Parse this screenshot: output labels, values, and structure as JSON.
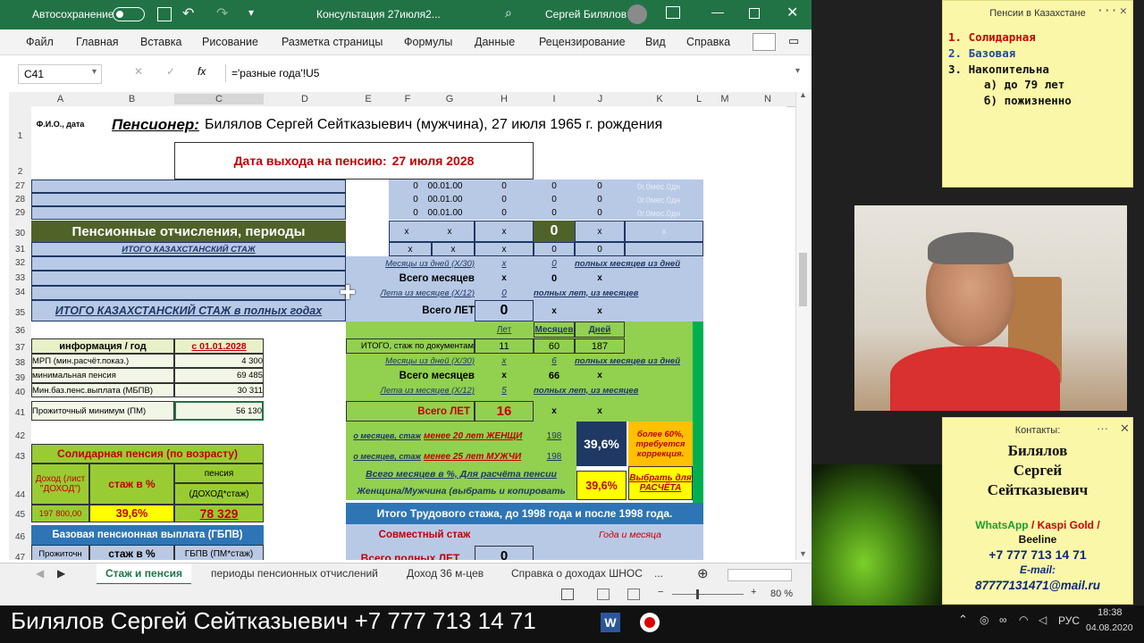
{
  "titlebar": {
    "autosave": "Автосохранение",
    "doc_title": "Консультация 27июля2...",
    "user": "Сергей Билялов"
  },
  "ribbon_tabs": [
    "Файл",
    "Главная",
    "Вставка",
    "Рисование",
    "Разметка страницы",
    "Формулы",
    "Данные",
    "Рецензирование",
    "Вид",
    "Справка"
  ],
  "formula_bar": {
    "name_box": "C41",
    "formula": "='разные года'!U5"
  },
  "columns": [
    "A",
    "B",
    "C",
    "D",
    "E",
    "F",
    "G",
    "H",
    "I",
    "J",
    "K",
    "L",
    "M",
    "N"
  ],
  "rows": [
    "1",
    "2",
    "27",
    "28",
    "29",
    "30",
    "31",
    "32",
    "33",
    "34",
    "35",
    "36",
    "37",
    "38",
    "39",
    "40",
    "41",
    "42",
    "43",
    "44",
    "45",
    "46",
    "47"
  ],
  "sheet": {
    "a1": "Ф.И.О., дата",
    "pensioner_label": "Пенсионер:",
    "pensioner_text": "Билялов Сергей Сейтказыевич (мужчина), 27 июля 1965 г. рождения",
    "retire_label": "Дата выхода на пенсию:",
    "retire_date": "27 июля 2028",
    "r27_f": "0",
    "r27_g": "00.01.00",
    "r27_h": "0",
    "r27_i": "0",
    "r27_j": "0",
    "r27_k": "0г.0мес.0дн",
    "r28_f": "0",
    "r28_g": "00.01.00",
    "r28_h": "0",
    "r28_i": "0",
    "r28_j": "0",
    "r28_k": "0г.0мес.0дн",
    "r29_f": "0",
    "r29_g": "00.01.00",
    "r29_h": "0",
    "r29_i": "0",
    "r29_j": "0",
    "r29_k": "0г.0мес.0дн",
    "periods_title": "Пенсионные отчисления, периоды",
    "x": "x",
    "r30_i": "0",
    "kz_total": "ИТОГО КАЗАХСТАНСКИЙ СТАЖ",
    "r31_i": "0",
    "r31_j": "0",
    "months_from_days": "Месяцы из дней (Х/30)",
    "full_months_from_days": "полных месяцев из дней",
    "r32_i": "0",
    "total_months": "Всего месяцев",
    "r33_i": "0",
    "years_from_months": "Лета из месяцев (Х/12)",
    "full_years_months": "полных лет, из месяцев",
    "r34_h": "0",
    "kz_total_full_years": "ИТОГО КАЗАХСТАНСКИЙ СТАЖ в полных годах",
    "total_years": "Всего ЛЕТ",
    "r35_h": "0",
    "years_hdr": "Лет",
    "months_hdr": "Месяцев",
    "days_hdr": "Дней",
    "info_year": "информация / год",
    "from_date": "с 01.01.2028",
    "doc_total": "ИТОГО, стаж по документам",
    "r37_h": "11",
    "r37_i": "60",
    "r37_j": "187",
    "mrp": "МРП (мин.расчёт.показ.)",
    "mrp_val": "4 300",
    "months_from_days2": "Месяцы из дней (Х/30)",
    "r38_i": "6",
    "full_months_from_days2": "полных месяцев из дней",
    "min_pension": "минимальная пенсия",
    "min_pension_val": "69 485",
    "total_months2": "Всего месяцев",
    "r39_i": "66",
    "mbpv": "Мин.баз.пенс.выплата (МБПВ)",
    "mbpv_val": "30 311",
    "years_from_months2": "Лета из месяцев (Х/12)",
    "r40_h": "5",
    "full_years_months2": "полных лет, из месяцев",
    "pm": "Прожиточный минимум (ПМ)",
    "pm_val": "56 130",
    "total_years2": "Всего ЛЕТ",
    "r41_h": "16",
    "months_stazh_women": "о месяцев, стаж",
    "less20": "менее 20 лет ЖЕНЩИ",
    "r42_i": "198",
    "pct_box": "39,6%",
    "more60": "более 60%, требуется коррекция.",
    "solidary": "Солидарная пенсия (по возрасту)",
    "months_stazh_men": "о месяцев, стаж",
    "less25": "менее 25 лет МУЖЧИ",
    "r43_i": "198",
    "income_label": "Доход (лист \"ДОХОД\")",
    "stazh_pct": "стаж в %",
    "pension_label": "пенсия",
    "income_stazh": "(ДОХОД*стаж)",
    "all_months_pct": "Всего месяцев в %, Для расчёта пенсии",
    "woman_man": "Женщина/Мужчина (выбрать и копировать",
    "pct_yellow": "39,6%",
    "choose": "Выбрать для РАСЧЁТА",
    "income_val": "197 800,00",
    "stazh_val": "39,6%",
    "pension_val": "78 329",
    "work_total": "Итого Трудового стажа, до 1998 года и после 1998 года.",
    "base_payout": "Базовая пенсионная выплата (ГБПВ)",
    "joint_stazh": "Совместный стаж",
    "years_months": "Года и месяца",
    "lifetime_short": "Прожиточн",
    "stazh_pct2": "стаж в %",
    "gbpv": "ГБПВ (ПМ*стаж)",
    "total_full": "Всего полных ЛЕТ",
    "r47_h": "0"
  },
  "sheet_tabs": [
    "Стаж и пенсия",
    "периоды пенсионных отчислений",
    "Доход 36 м-цев",
    "Справка о доходах ШНОС",
    "..."
  ],
  "status": {
    "zoom": "80 %"
  },
  "note1": {
    "title": "Пенсии в Казахстане",
    "items": [
      "1. Солидарная",
      "2. Базовая",
      "3. Накопительна"
    ],
    "sub": [
      "а) до 79 лет",
      "б) пожизненно"
    ]
  },
  "note2": {
    "title": "Контакты:",
    "name1": "Билялов",
    "name2": "Сергей",
    "name3": "Сейтказыевич",
    "wa": "WhatsApp",
    "slash1": "/",
    "kaspi": "Kaspi Gold",
    "slash2": "/",
    "beeline": "Beeline",
    "phone": "+7 777 713 14 71",
    "email_label": "E-mail:",
    "email": "87777131471@mail.ru"
  },
  "caption": "Билялов Сергей Сейтказыевич +7 777 713 14 71",
  "tray": {
    "lang": "РУС",
    "time": "18:38",
    "date": "04.08.2020"
  }
}
